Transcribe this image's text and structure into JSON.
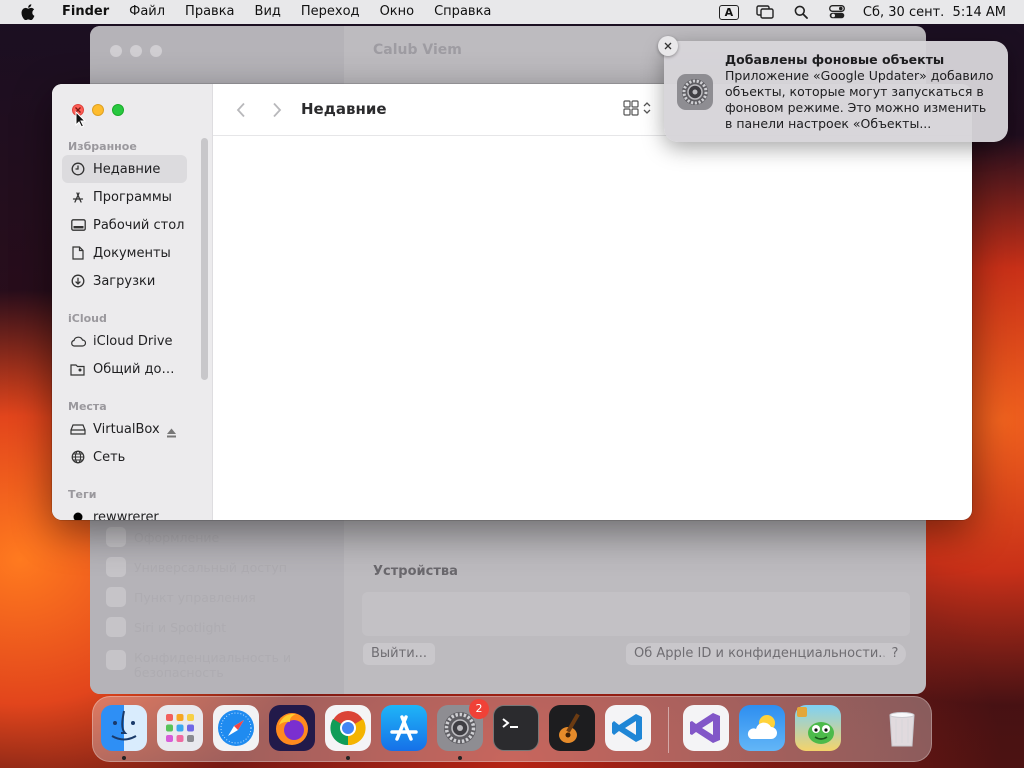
{
  "menubar": {
    "app": "Finder",
    "items": [
      "Файл",
      "Правка",
      "Вид",
      "Переход",
      "Окно",
      "Справка"
    ],
    "input_source": "A",
    "clock": "Сб, 30 сент.  5:14 AM"
  },
  "background_window": {
    "title": "Calub Viem",
    "sidebar_items": [
      "Оформление",
      "Универсальный доступ",
      "Пункт управления",
      "Siri и Spotlight",
      "Конфиденциальность и безопасность"
    ],
    "devices_heading": "Устройства",
    "logout_button": "Выйти...",
    "apple_id_button": "Об Apple ID и конфиденциальности...",
    "help_button": "?"
  },
  "finder": {
    "title": "Недавние",
    "favorites_heading": "Избранное",
    "favorites": [
      {
        "label": "Недавние",
        "icon": "clock-icon"
      },
      {
        "label": "Программы",
        "icon": "apps-icon"
      },
      {
        "label": "Рабочий стол",
        "icon": "desktop-icon"
      },
      {
        "label": "Документы",
        "icon": "document-icon"
      },
      {
        "label": "Загрузки",
        "icon": "download-icon"
      }
    ],
    "icloud_heading": "iCloud",
    "icloud": [
      {
        "label": "iCloud Drive",
        "icon": "cloud-icon"
      },
      {
        "label": "Общий доступ",
        "icon": "shared-folder-icon"
      }
    ],
    "places_heading": "Места",
    "places": [
      {
        "label": "VirtualBox",
        "icon": "drive-icon"
      },
      {
        "label": "Сеть",
        "icon": "globe-icon"
      }
    ],
    "tags_heading": "Теги",
    "tags": [
      {
        "label": "rewwrerer",
        "color": "#000000"
      }
    ]
  },
  "notification": {
    "title": "Добавлены фоновые объекты",
    "body": "Приложение «Google Updater» добавило объекты, которые могут запускаться в фоновом режиме. Это можно изменить в панели настроек «Объекты..."
  },
  "dock": {
    "badge_settings": "2",
    "apps": [
      "Finder",
      "Launchpad",
      "Safari",
      "Firefox",
      "Chrome",
      "App Store",
      "System Settings",
      "Terminal",
      "GarageBand",
      "VS Code",
      "Visual Studio",
      "Weather",
      "Game",
      "Trash"
    ]
  }
}
